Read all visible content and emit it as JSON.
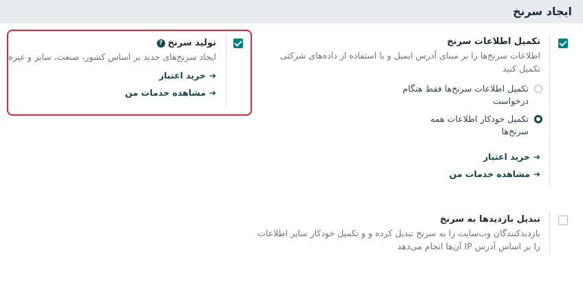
{
  "section_title": "ایجاد سرنخ",
  "enrichment": {
    "title": "تکمیل اطلاعات سرنخ",
    "description_lines": [
      "اطلاعات سرنخ‌ها را بر مبنای آدرس ایمیل و با استفاده از داده‌های شرکتی",
      "تکمیل کنید"
    ],
    "checked": true,
    "options": [
      {
        "label_lines": [
          "تکمیل اطلاعات سرنخ‌ها فقط هنگام",
          "درخواست"
        ],
        "selected": false
      },
      {
        "label_lines": [
          "تکمیل خودکار اطلاعات همه",
          "سرنخ‌ها"
        ],
        "selected": true
      }
    ],
    "links": [
      "خرید اعتبار",
      "مشاهده خدمات من"
    ]
  },
  "lead_generation": {
    "title": "تولید سرنخ",
    "description": "ایجاد سرنخ‌های جدید بر اساس کشور، صنعت، سایز و غیره",
    "checked": true,
    "links": [
      "خرید اعتبار",
      "مشاهده خدمات من"
    ],
    "highlight_color": "#d6263a"
  },
  "visits_to_leads": {
    "title": "تبدیل بازدیدها به سرنخ",
    "description_lines": [
      "بازدیدکنندگان وب‌سایت را به سرنخ تبدیل کرده و و تکمیل خودکار سایر اطلاعات",
      "را بر اساس آدرس IP آن‌ها انجام می‌دهد"
    ],
    "checked": false
  },
  "colors": {
    "accent": "#017e84",
    "link": "#11474b",
    "header_bg": "#e9ecef"
  }
}
